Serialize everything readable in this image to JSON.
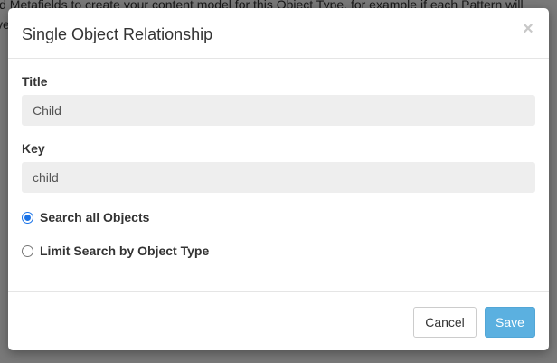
{
  "background_page": {
    "line_1": "ld Metafields to create your content model for this Object Type, for example if each Pattern will",
    "line_2": "ve"
  },
  "modal": {
    "title": "Single Object Relationship",
    "close_symbol": "×",
    "fields": [
      {
        "label": "Title",
        "value": "Child"
      },
      {
        "label": "Key",
        "value": "child"
      }
    ],
    "search_options": [
      {
        "label": "Search all Objects",
        "checked": true
      },
      {
        "label": "Limit Search by Object Type",
        "checked": false
      }
    ],
    "footer": {
      "cancel_label": "Cancel",
      "save_label": "Save"
    }
  },
  "colors": {
    "accent_radio": "#1a73e8",
    "save_button": "#5bb0e0",
    "input_background": "#eeeeee"
  }
}
